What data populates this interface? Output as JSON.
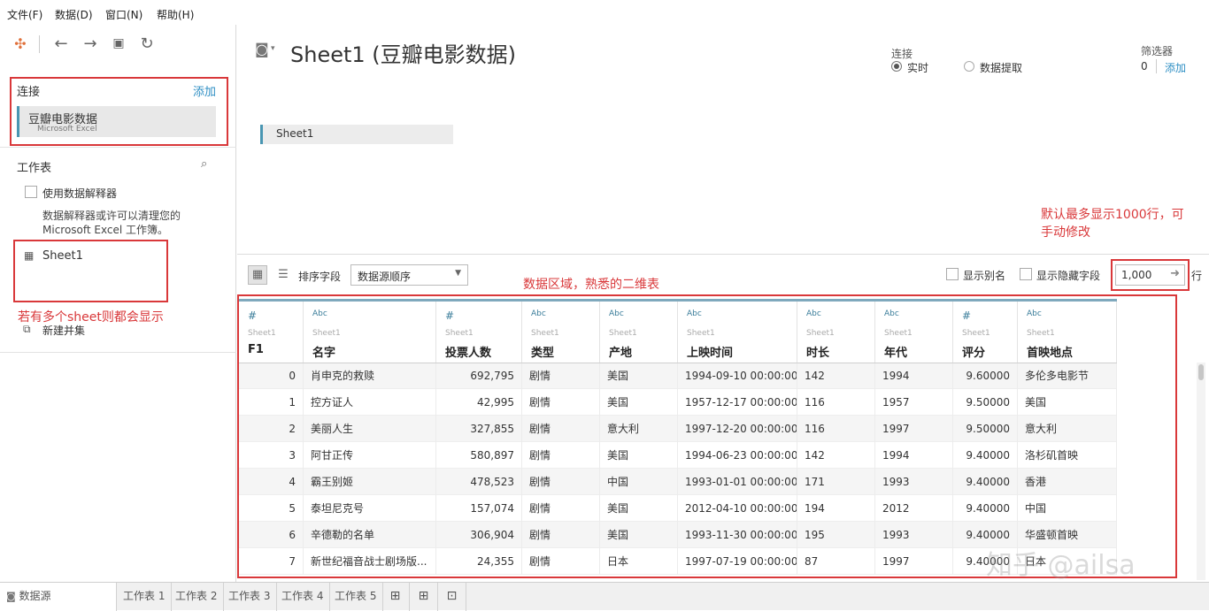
{
  "menu": [
    "文件(F)",
    "数据(D)",
    "窗口(N)",
    "帮助(H)"
  ],
  "left": {
    "connections_title": "连接",
    "add_label": "添加",
    "connection": {
      "name": "豆瓣电影数据",
      "type": "Microsoft Excel"
    },
    "worksheet_title": "工作表",
    "interpreter_label": "使用数据解释器",
    "interpreter_desc_1": "数据解释器或许可以清理您的",
    "interpreter_desc_2": "Microsoft Excel 工作簿。",
    "sheet_name": "Sheet1",
    "annotation_sheets": "若有多个sheet则都会显示",
    "new_union": "新建并集"
  },
  "main": {
    "title": "Sheet1 (豆瓣电影数据)",
    "connection_label": "连接",
    "live_label": "实时",
    "extract_label": "数据提取",
    "filter_label": "筛选器",
    "filter_count": "0",
    "filter_add": "添加",
    "canvas_table": "Sheet1",
    "annotation_rows_1": "默认最多显示1000行，可",
    "annotation_rows_2": "手动修改",
    "sort_label": "排序字段",
    "sort_value": "数据源顺序",
    "annotation_grid": "数据区域，熟悉的二维表",
    "show_alias": "显示别名",
    "show_hidden": "显示隐藏字段",
    "rows_value": "1,000",
    "rows_unit": "行"
  },
  "grid": {
    "columns": [
      {
        "type": "#",
        "src": "Sheet1",
        "name": "F1"
      },
      {
        "type": "Abc",
        "src": "Sheet1",
        "name": "名字"
      },
      {
        "type": "#",
        "src": "Sheet1",
        "name": "投票人数"
      },
      {
        "type": "Abc",
        "src": "Sheet1",
        "name": "类型"
      },
      {
        "type": "Abc",
        "src": "Sheet1",
        "name": "产地"
      },
      {
        "type": "Abc",
        "src": "Sheet1",
        "name": "上映时间"
      },
      {
        "type": "Abc",
        "src": "Sheet1",
        "name": "时长"
      },
      {
        "type": "Abc",
        "src": "Sheet1",
        "name": "年代"
      },
      {
        "type": "#",
        "src": "Sheet1",
        "name": "评分"
      },
      {
        "type": "Abc",
        "src": "Sheet1",
        "name": "首映地点"
      }
    ],
    "rows": [
      [
        "0",
        "肖申克的救赎",
        "692,795",
        "剧情",
        "美国",
        "1994-09-10 00:00:00",
        "142",
        "1994",
        "9.60000",
        "多伦多电影节"
      ],
      [
        "1",
        "控方证人",
        "42,995",
        "剧情",
        "美国",
        "1957-12-17 00:00:00",
        "116",
        "1957",
        "9.50000",
        "美国"
      ],
      [
        "2",
        "美丽人生",
        "327,855",
        "剧情",
        "意大利",
        "1997-12-20 00:00:00",
        "116",
        "1997",
        "9.50000",
        "意大利"
      ],
      [
        "3",
        "阿甘正传",
        "580,897",
        "剧情",
        "美国",
        "1994-06-23 00:00:00",
        "142",
        "1994",
        "9.40000",
        "洛杉矶首映"
      ],
      [
        "4",
        "霸王别姬",
        "478,523",
        "剧情",
        "中国",
        "1993-01-01 00:00:00",
        "171",
        "1993",
        "9.40000",
        "香港"
      ],
      [
        "5",
        "泰坦尼克号",
        "157,074",
        "剧情",
        "美国",
        "2012-04-10 00:00:00",
        "194",
        "2012",
        "9.40000",
        "中国"
      ],
      [
        "6",
        "辛德勒的名单",
        "306,904",
        "剧情",
        "美国",
        "1993-11-30 00:00:00",
        "195",
        "1993",
        "9.40000",
        "华盛顿首映"
      ],
      [
        "7",
        "新世纪福音战士剧场版...",
        "24,355",
        "剧情",
        "日本",
        "1997-07-19 00:00:00",
        "87",
        "1997",
        "9.40000",
        "日本"
      ]
    ]
  },
  "bottom_tabs": [
    "数据源",
    "工作表 1",
    "工作表 2",
    "工作表 3",
    "工作表 4",
    "工作表 5"
  ],
  "watermark": "知乎 @ailsa",
  "colors": {
    "accent": "#4996b2",
    "annotation": "#d9383a",
    "link": "#2f8fc4"
  }
}
